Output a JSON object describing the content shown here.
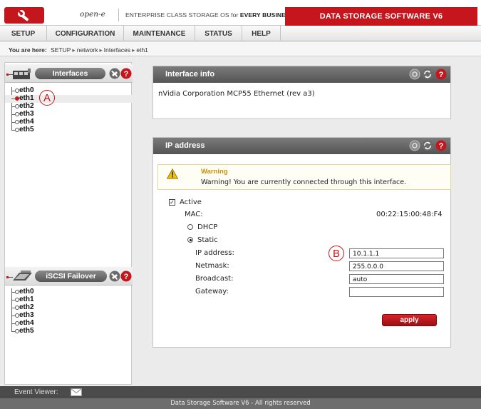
{
  "header": {
    "brand": "open-e",
    "tagline_pre": "ENTERPRISE CLASS STORAGE OS for ",
    "tagline_bold": "EVERY BUSINESS",
    "product": "DATA STORAGE SOFTWARE V6"
  },
  "menu": [
    "SETUP",
    "CONFIGURATION",
    "MAINTENANCE",
    "STATUS",
    "HELP"
  ],
  "breadcrumb": {
    "label": "You are here:",
    "items": [
      "SETUP",
      "network",
      "Interfaces",
      "eth1"
    ]
  },
  "left": {
    "interfaces": {
      "title": "Interfaces",
      "items": [
        "eth0",
        "eth1",
        "eth2",
        "eth3",
        "eth4",
        "eth5"
      ],
      "selected": "eth1"
    },
    "failover": {
      "title": "iSCSI Failover",
      "items": [
        "eth0",
        "eth1",
        "eth2",
        "eth3",
        "eth4",
        "eth5"
      ]
    }
  },
  "annotations": {
    "a": "A",
    "b": "B"
  },
  "interface_info": {
    "title": "Interface info",
    "description": "nVidia Corporation MCP55 Ethernet (rev a3)"
  },
  "ip_address": {
    "title": "IP address",
    "warning_title": "Warning",
    "warning_text": "Warning! You are currently connected through this interface.",
    "active_label": "Active",
    "active_checked": true,
    "mac_label": "MAC:",
    "mac_value": "00:22:15:00:48:F4",
    "dhcp_label": "DHCP",
    "static_label": "Static",
    "mode": "Static",
    "fields": {
      "ip_label": "IP address:",
      "ip_value": "10.1.1.1",
      "netmask_label": "Netmask:",
      "netmask_value": "255.0.0.0",
      "broadcast_label": "Broadcast:",
      "broadcast_value": "auto",
      "gateway_label": "Gateway:",
      "gateway_value": ""
    },
    "apply_label": "apply"
  },
  "event_viewer": {
    "label": "Event Viewer:"
  },
  "footer": {
    "text": "Data Storage Software V6 - All rights reserved"
  },
  "colors": {
    "brand_red": "#c4161c",
    "header_gray": "#5e5e5e",
    "warning_title": "#c8900a"
  }
}
